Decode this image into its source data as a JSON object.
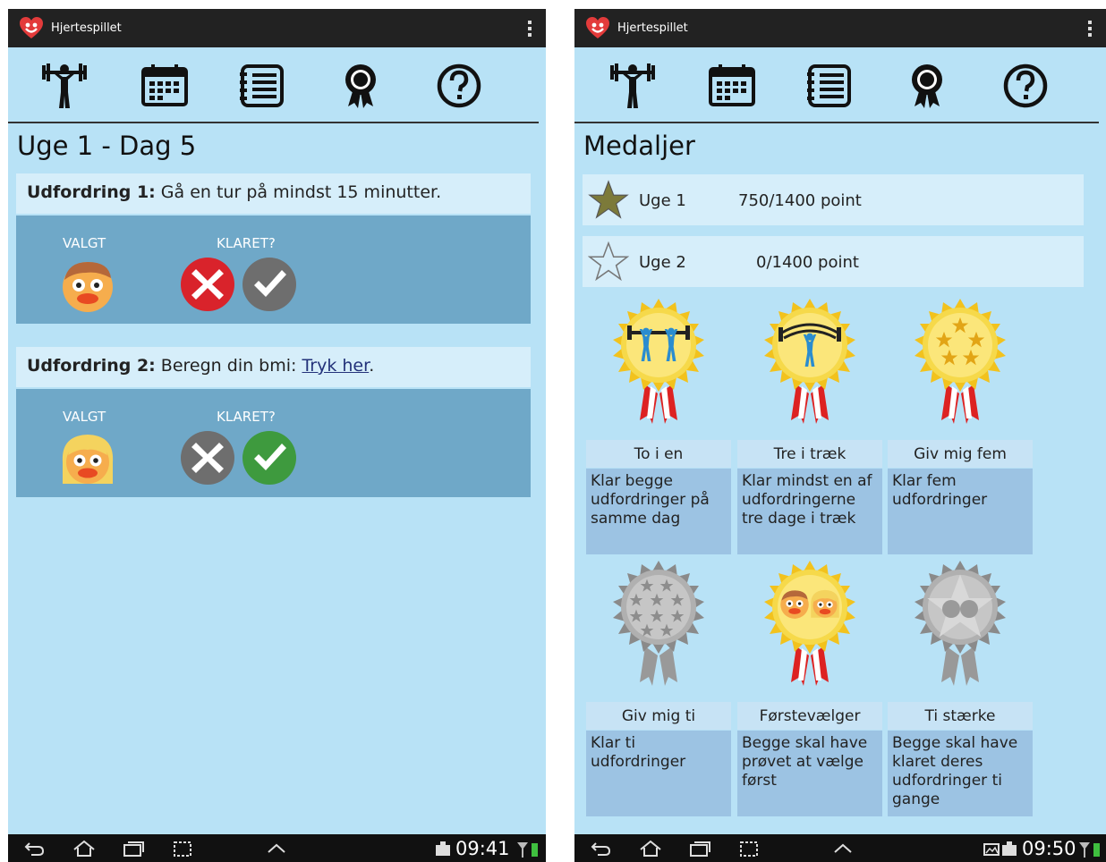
{
  "app": {
    "title": "Hjertespillet"
  },
  "nav_icons": [
    "weightlifter-icon",
    "calendar-icon",
    "list-icon",
    "medal-icon",
    "help-icon"
  ],
  "left_screen": {
    "title": "Uge 1 - Dag 5",
    "challenge1": {
      "label": "Udfordring 1:",
      "text": " Gå en tur på mindst 15 minutter.",
      "chosen_label": "VALGT",
      "done_label": "KLARET?",
      "chosen_face": "boy-face-icon",
      "status": "not-completed"
    },
    "challenge2": {
      "label": "Udfordring 2:",
      "text": " Beregn din bmi: ",
      "link": "Tryk her",
      "suffix": ".",
      "chosen_label": "VALGT",
      "done_label": "KLARET?",
      "chosen_face": "girl-face-icon",
      "status": "completed"
    },
    "clock": "09:41"
  },
  "right_screen": {
    "title": "Medaljer",
    "weeks": [
      {
        "label": "Uge 1",
        "points": "750/1400 point",
        "earned": true
      },
      {
        "label": "Uge 2",
        "points": "0/1400 point",
        "earned": false
      }
    ],
    "medals": [
      {
        "name": "To i en",
        "desc": "Klar begge udfordringer på samme dag",
        "earned": true,
        "icon": "two-lifters-medal-icon"
      },
      {
        "name": "Tre i træk",
        "desc": "Klar mindst en af udfordringerne tre dage i træk",
        "earned": true,
        "icon": "lifter-medal-icon"
      },
      {
        "name": "Giv mig fem",
        "desc": "Klar fem udfordringer",
        "earned": true,
        "icon": "five-stars-medal-icon"
      },
      {
        "name": "Giv mig ti",
        "desc": "Klar ti udfordringer",
        "earned": false,
        "icon": "ten-stars-medal-icon"
      },
      {
        "name": "Førstevælger",
        "desc": "Begge skal have prøvet at vælge først",
        "earned": true,
        "icon": "faces-medal-icon"
      },
      {
        "name": "Ti stærke",
        "desc": "Begge skal have klaret deres udfordringer ti gange",
        "earned": false,
        "icon": "faces-star-medal-icon"
      }
    ],
    "clock": "09:50"
  },
  "colors": {
    "screen_bg": "#b8e2f6",
    "header_light": "#d6eefa",
    "challenge_panel": "#6fa8c8",
    "medal_desc_bg": "#9cc3e3",
    "fail_red": "#d9232b",
    "success_green": "#3e9a3e",
    "neutral_grey": "#6e6e6e",
    "gold": "#f2c21d"
  }
}
